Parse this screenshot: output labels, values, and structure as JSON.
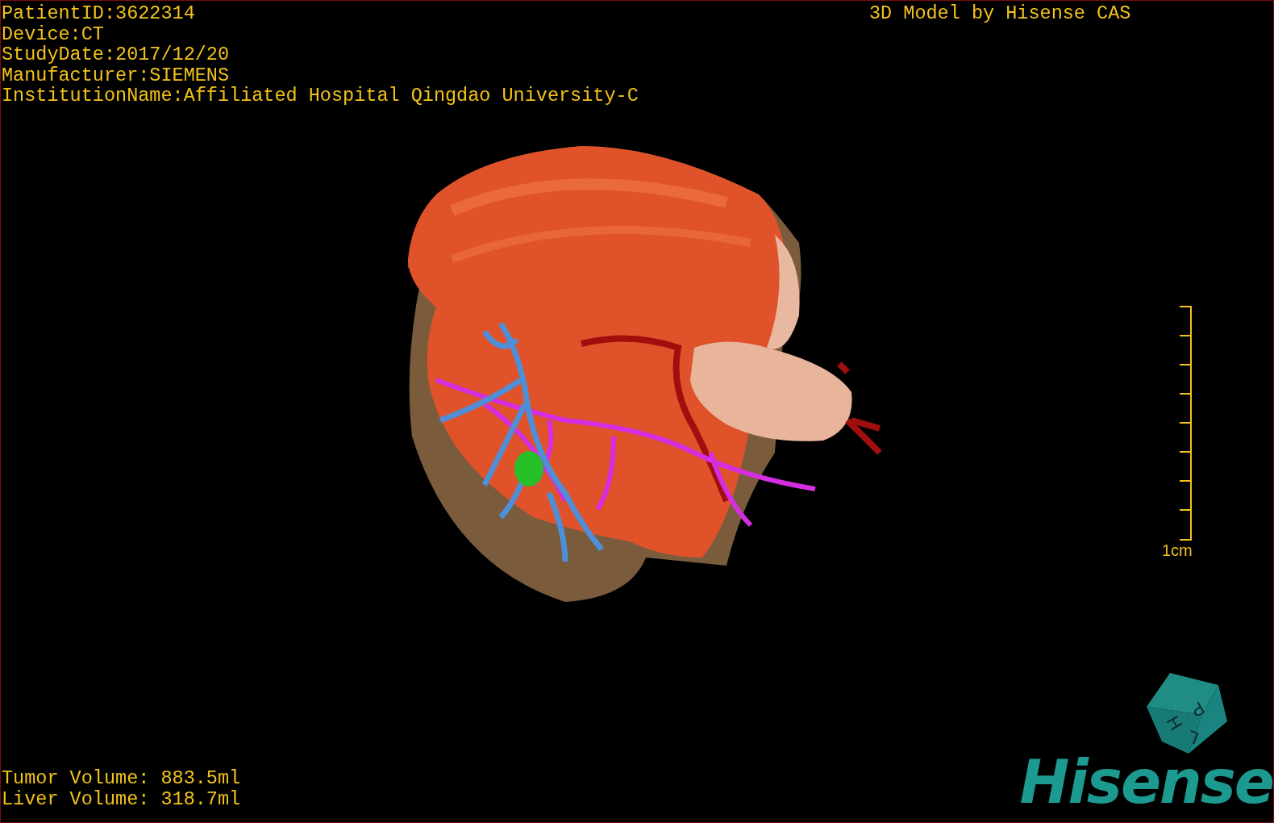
{
  "patient_info": [
    "PatientID:3622314",
    "Device:CT",
    "StudyDate:2017/12/20",
    "Manufacturer:SIEMENS",
    "InstitutionName:Affiliated Hospital Qingdao University-C"
  ],
  "title": "3D Model by Hisense CAS",
  "scale_bar": {
    "label": "1cm"
  },
  "volumes": [
    "Tumor Volume: 883.5ml",
    "Liver Volume: 318.7ml"
  ],
  "orientation_cube": {
    "faces": [
      "H",
      "P",
      "L"
    ]
  },
  "logo": "Hisense"
}
